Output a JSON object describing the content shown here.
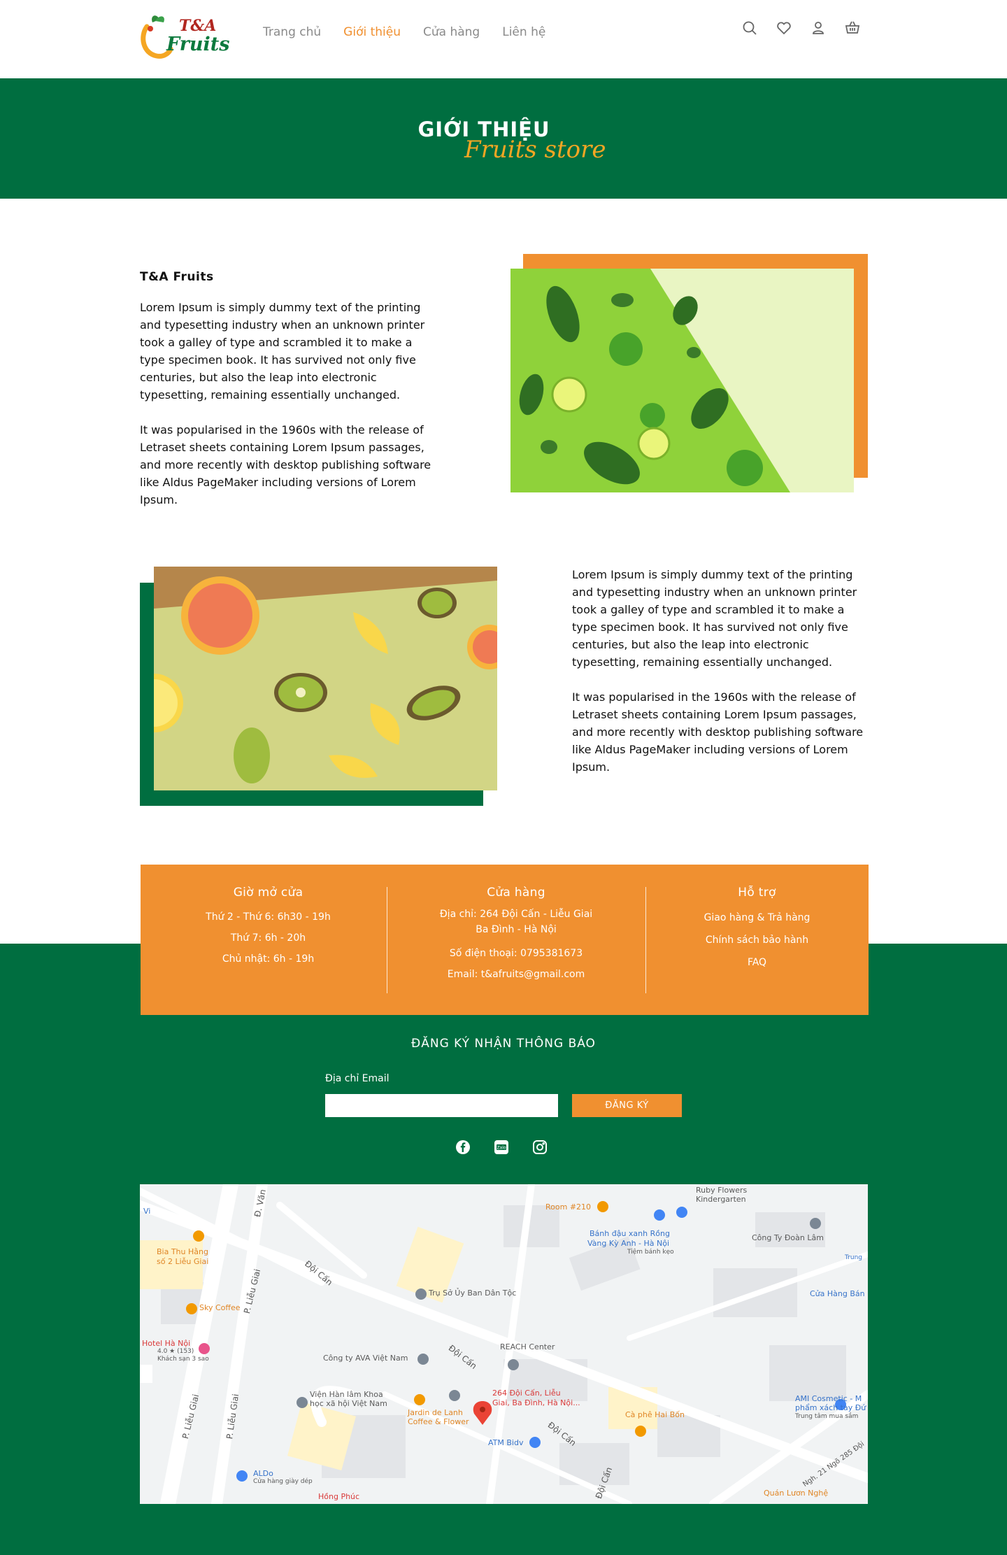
{
  "header": {
    "logo_ta": "T&A",
    "logo_fruits": "Fruits",
    "nav": [
      {
        "label": "Trang chủ",
        "active": false
      },
      {
        "label": "Giới thiệu",
        "active": true
      },
      {
        "label": "Cửa hàng",
        "active": false
      },
      {
        "label": "Liên hệ",
        "active": false
      }
    ],
    "icons": [
      "search-icon",
      "heart-icon",
      "user-icon",
      "cart-icon"
    ]
  },
  "banner": {
    "title": "GIỚI THIỆU",
    "subtitle": "Fruits store"
  },
  "about": {
    "title": "T&A Fruits",
    "para1": "Lorem Ipsum is simply dummy text of the printing and typesetting industry when an unknown printer took a galley of type and scrambled it to make a type specimen book. It has survived not only five centuries, but also the leap into electronic typesetting, remaining essentially unchanged.",
    "para2": "It was popularised in the 1960s with the release of Letraset sheets containing Lorem Ipsum passages, and more recently with desktop publishing software like Aldus PageMaker including versions of Lorem Ipsum."
  },
  "about2": {
    "para1": "Lorem Ipsum is simply dummy text of the printing and typesetting industry when an unknown printer took a galley of type and scrambled it to make a type specimen book. It has survived not only five centuries, but also the leap into electronic typesetting, remaining essentially unchanged.",
    "para2": "It was popularised in the 1960s with the release of Letraset sheets containing Lorem Ipsum passages, and more recently with desktop publishing software like Aldus PageMaker including versions of Lorem Ipsum."
  },
  "info": {
    "hours": {
      "title": "Giờ mở cửa",
      "lines": [
        "Thứ 2 - Thứ 6: 6h30 - 19h",
        "Thứ 7: 6h - 20h",
        "Chủ nhật: 6h - 19h"
      ]
    },
    "store": {
      "title": "Cửa hàng",
      "address": "Địa chỉ: 264 Đội Cấn - Liễu Giai",
      "address2": "Ba Đình - Hà Nội",
      "phone": "Số điện thoại: 0795381673",
      "email": "Email: t&afruits@gmail.com"
    },
    "support": {
      "title": "Hỗ trợ",
      "lines": [
        "Giao hàng & Trả hàng",
        "Chính sách bảo hành",
        "FAQ"
      ]
    }
  },
  "newsletter": {
    "title": "ĐĂNG KÝ NHẬN THÔNG BÁO",
    "email_label": "Địa chỉ Email",
    "email_value": "",
    "button": "ĐĂNG KÝ",
    "social": [
      "facebook-icon",
      "zalo-icon",
      "instagram-icon"
    ]
  },
  "map": {
    "labels": {
      "ruby": "Ruby Flowers",
      "ruby2": "Kindergarten",
      "room": "Room #210",
      "banh": "Bánh đậu xanh Rồng",
      "banh2": "Vàng Kỳ Anh - Hà Nội",
      "banh3": "Tiệm bánh kẹo",
      "congty_doan": "Công Ty Đoàn Lâm",
      "trung": "Trung",
      "cuahang": "Cửa Hàng Bán",
      "bia": "Bia Thu Hằng",
      "bia2": "số 2 Liễu Giai",
      "sky": "Sky Coffee",
      "truso": "Trụ Sở Ủy Ban Dân Tộc",
      "hotel": "Hotel Hà Nội",
      "hotel2": "4.0 ★ (153)",
      "hotel3": "Khách sạn 3 sao",
      "ava": "Công ty AVA Việt Nam",
      "reach": "REACH Center",
      "vien": "Viện Hàn lâm Khoa",
      "vien2": "học xã hội Việt Nam",
      "jardin": "Jardin de Lanh",
      "jardin2": "Coffee & Flower",
      "pin": "264 Đội Cấn, Liễu",
      "pin2": "Giai, Ba Đình, Hà Nội...",
      "atm": "ATM Bidv",
      "caphe": "Cà phê Hai Bốn",
      "ami": "AMI Cosmetic - M",
      "ami2": "phẩm xách tay Đứ",
      "ami3": "Trung tâm mua sắm",
      "aldo": "ALDo",
      "aldo2": "Cửa hàng giày dép",
      "hongphuc": "Hồng Phúc",
      "quan": "Quán Lươn Nghệ",
      "vi": "Vi",
      "doican1": "Đội Cấn",
      "doican2": "Đội Cấn",
      "doican3": "Đội Cấn",
      "doican4": "Đội Cấn",
      "lieugiai1": "P. Liễu Giai",
      "lieugiai2": "P. Liễu Giai",
      "lieugiai3": "P. Liễu Giai",
      "dvan": "Đ. Văn",
      "ngh": "Ngh. 21 Ngõ 285 Đội"
    }
  }
}
